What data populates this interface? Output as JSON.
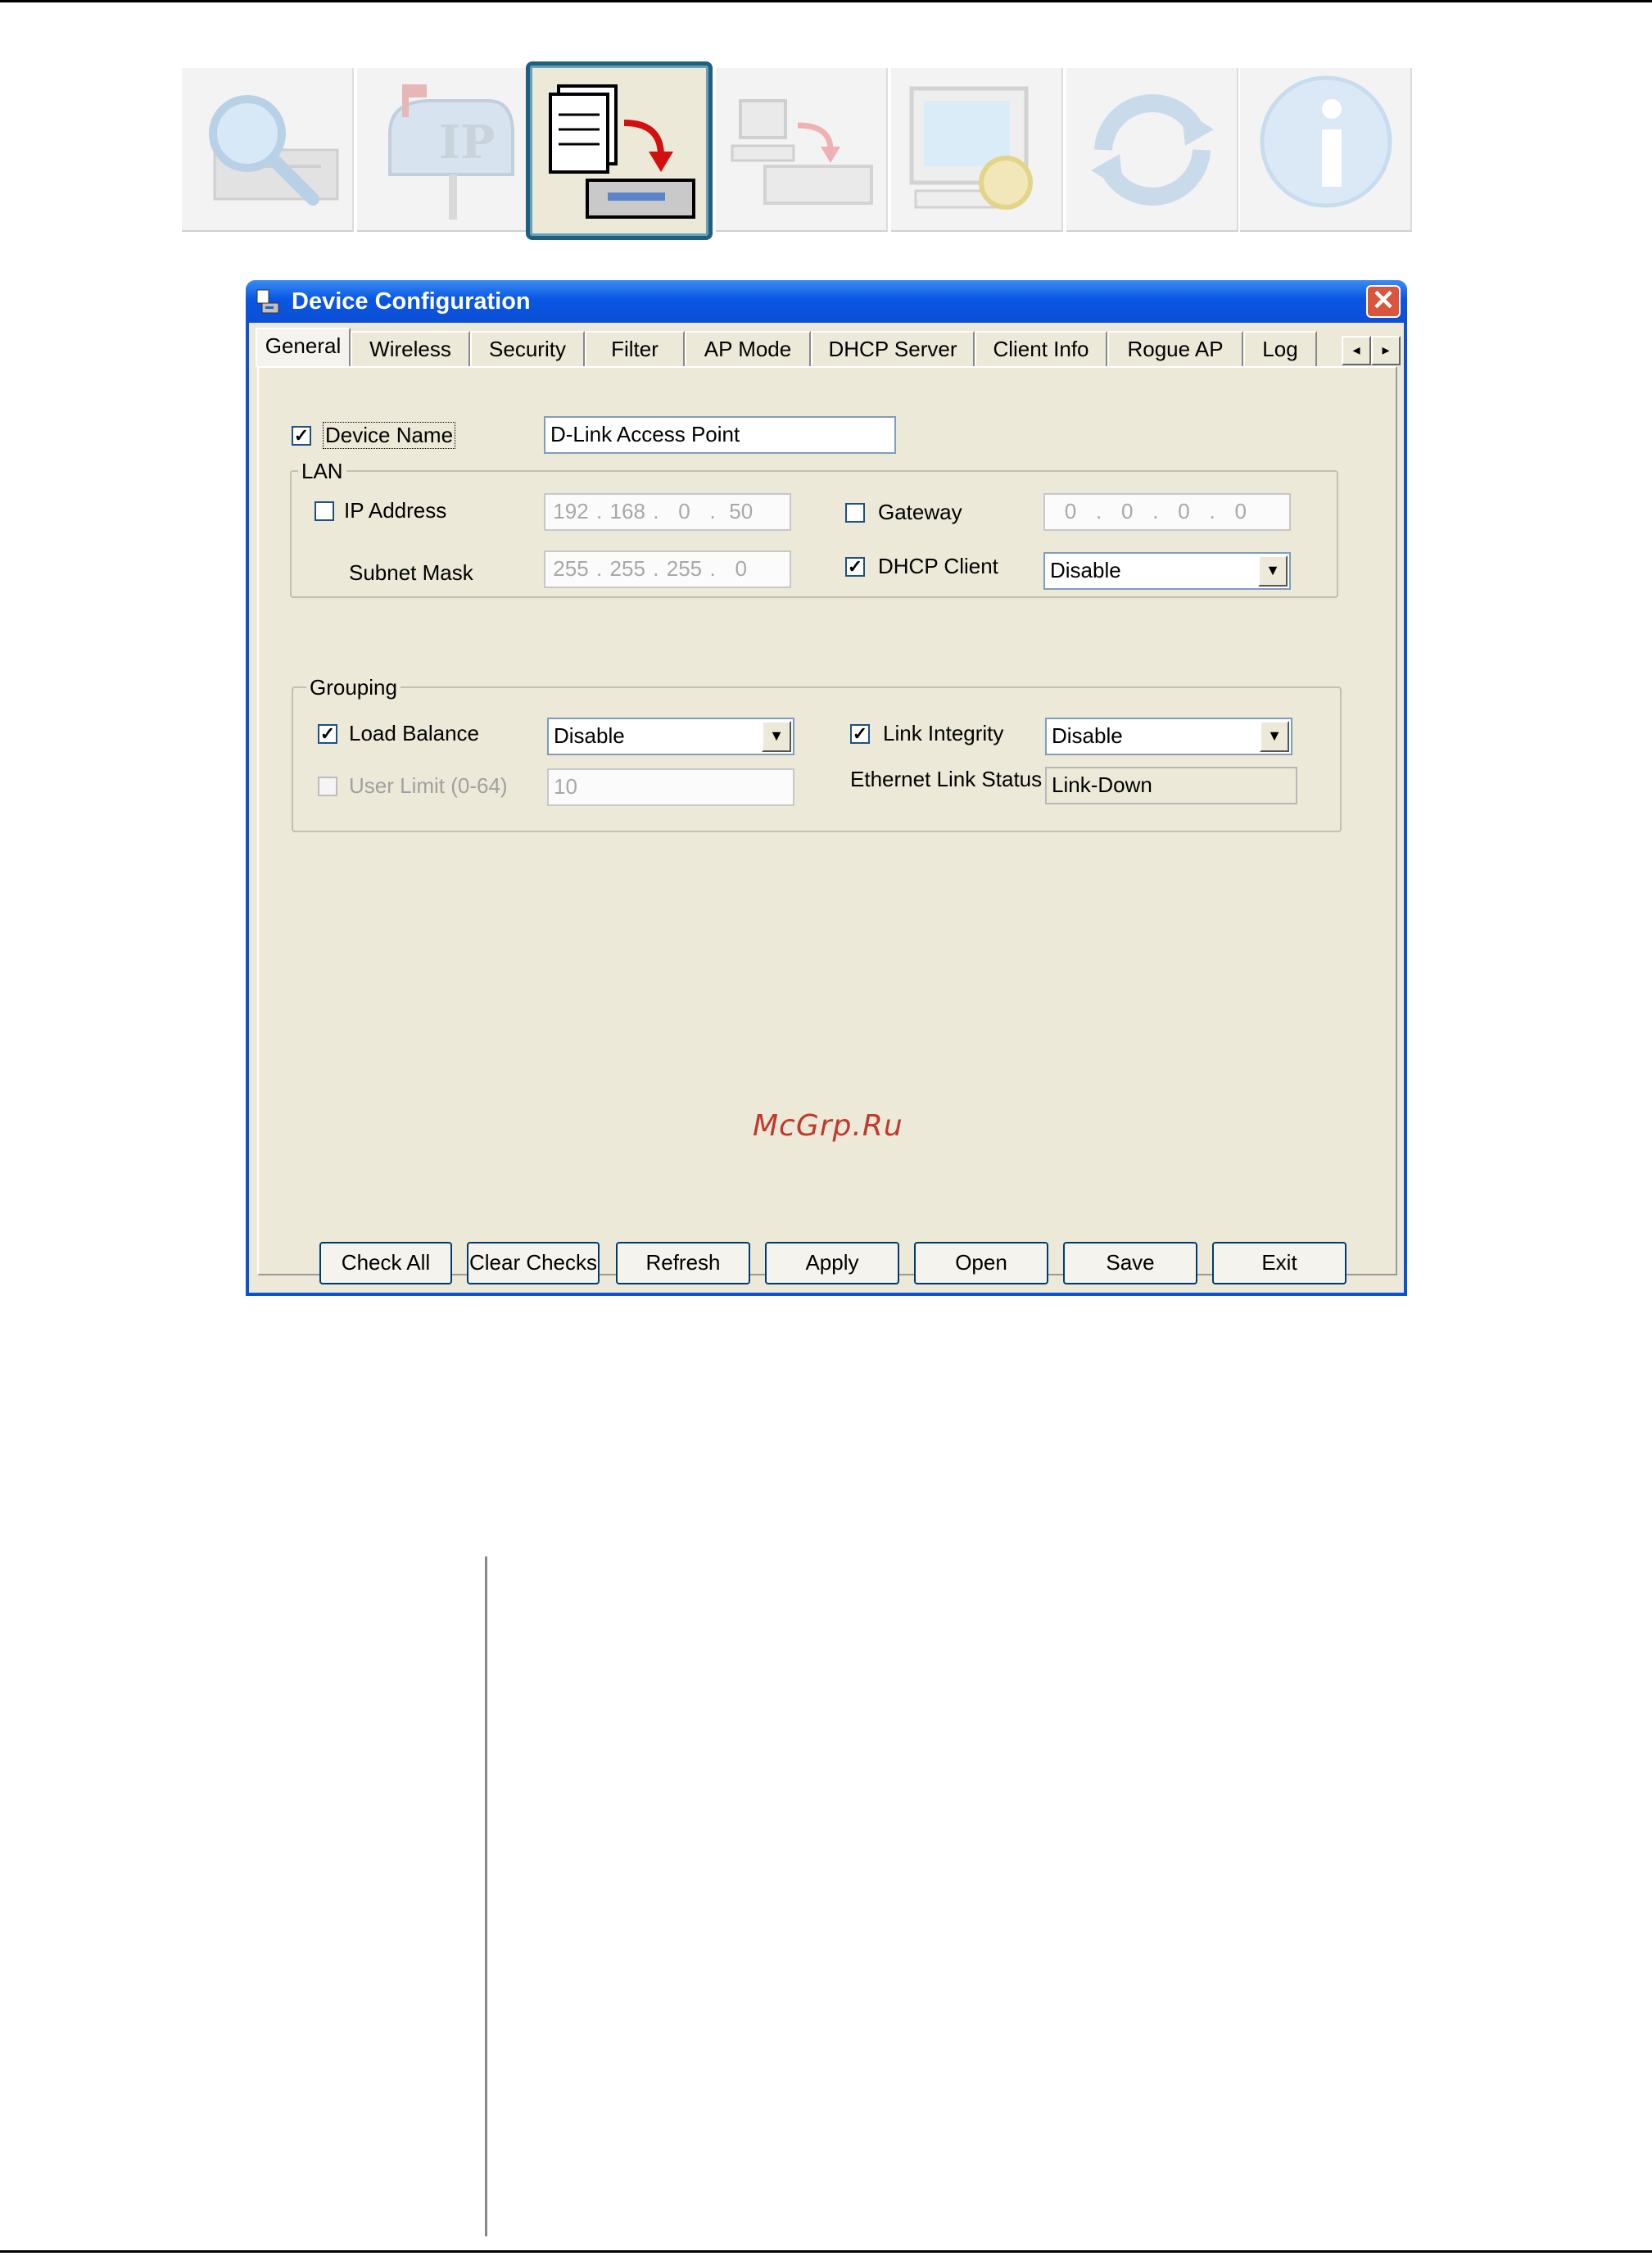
{
  "toolbar": {
    "buttons": [
      {
        "icon": "search-device-icon"
      },
      {
        "icon": "ip-mailbox-icon"
      },
      {
        "icon": "device-configuration-icon",
        "active": true
      },
      {
        "icon": "pc-to-device-icon"
      },
      {
        "icon": "monitor-gear-icon"
      },
      {
        "icon": "refresh-arrows-icon"
      },
      {
        "icon": "info-icon"
      }
    ]
  },
  "window": {
    "title": "Device Configuration",
    "close_label": "✕"
  },
  "tabs": [
    "General",
    "Wireless",
    "Security",
    "Filter",
    "AP Mode",
    "DHCP Server",
    "Client Info",
    "Rogue AP",
    "Log"
  ],
  "tab_scroll": {
    "left": "◂",
    "right": "▸"
  },
  "general": {
    "device_name_label": "Device Name",
    "device_name_value": "D-Link Access Point",
    "device_name_checked": "✓",
    "lan": {
      "title": "LAN",
      "ip_address_label": "IP Address",
      "ip_address": [
        "192",
        "168",
        "0",
        "50"
      ],
      "subnet_mask_label": "Subnet Mask",
      "subnet_mask": [
        "255",
        "255",
        "255",
        "0"
      ],
      "gateway_label": "Gateway",
      "gateway": [
        "0",
        "0",
        "0",
        "0"
      ],
      "dhcp_client_label": "DHCP Client",
      "dhcp_client_checked": "✓",
      "dhcp_client_value": "Disable"
    },
    "grouping": {
      "title": "Grouping",
      "load_balance_label": "Load Balance",
      "load_balance_checked": "✓",
      "load_balance_value": "Disable",
      "user_limit_label": "User Limit (0-64)",
      "user_limit_value": "10",
      "link_integrity_label": "Link Integrity",
      "link_integrity_checked": "✓",
      "link_integrity_value": "Disable",
      "ethernet_link_status_label": "Ethernet Link Status",
      "ethernet_link_status_value": "Link-Down"
    }
  },
  "buttons": {
    "check_all": "Check All",
    "clear_checks": "Clear Checks",
    "refresh": "Refresh",
    "apply": "Apply",
    "open": "Open",
    "save": "Save",
    "exit": "Exit"
  },
  "watermark": "McGrp.Ru",
  "colors": {
    "title_bar": "#0a56e4",
    "window_bg": "#ece9d8",
    "watermark": "#c0392b"
  }
}
